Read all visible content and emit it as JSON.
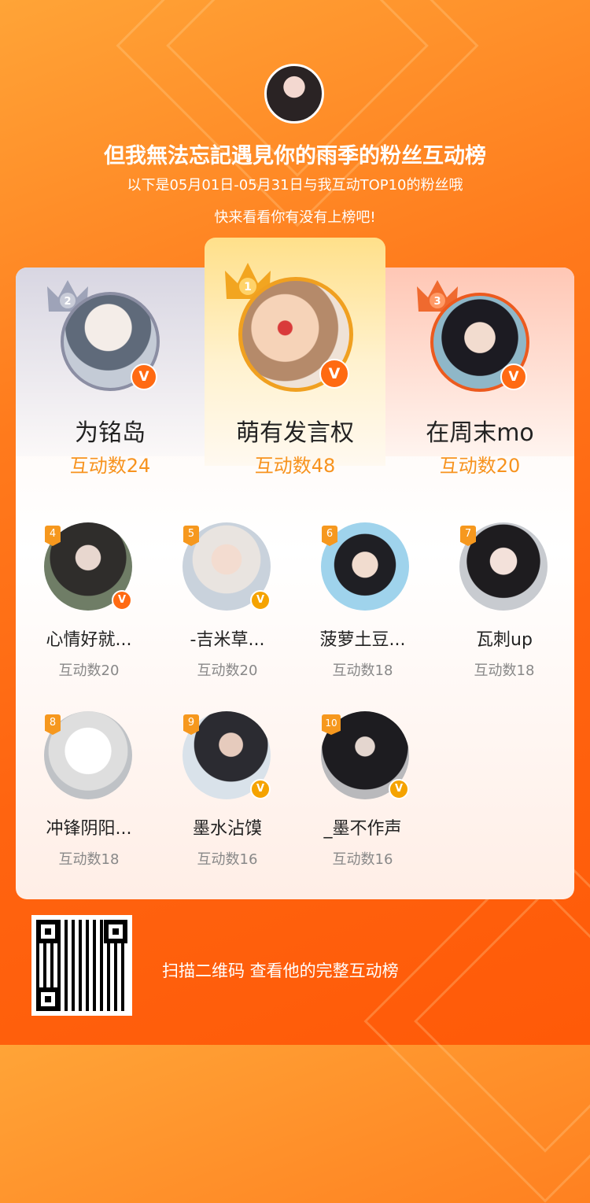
{
  "header": {
    "title": "但我無法忘記遇見你的雨季的粉丝互动榜",
    "subtitle_line1": "以下是05月01日-05月31日与我互动TOP10的粉丝哦",
    "subtitle_line2": "快来看看你有没有上榜吧!"
  },
  "top3": [
    {
      "rank": "1",
      "name": "萌有发言权",
      "count": "互动数48"
    },
    {
      "rank": "2",
      "name": "为铭岛",
      "count": "互动数24"
    },
    {
      "rank": "3",
      "name": "在周末mo",
      "count": "互动数20"
    }
  ],
  "fans": [
    {
      "rank": "4",
      "name": "心情好就...",
      "count": "互动数20"
    },
    {
      "rank": "5",
      "name": "-吉米草...",
      "count": "互动数20"
    },
    {
      "rank": "6",
      "name": "菠萝土豆...",
      "count": "互动数18"
    },
    {
      "rank": "7",
      "name": "瓦刺up",
      "count": "互动数18"
    },
    {
      "rank": "8",
      "name": "冲锋阴阳...",
      "count": "互动数18"
    },
    {
      "rank": "9",
      "name": "墨水沾馍",
      "count": "互动数16"
    },
    {
      "rank": "10",
      "name": "_墨不作声",
      "count": "互动数16"
    }
  ],
  "footer": {
    "scan_text": "扫描二维码 查看他的完整互动榜"
  },
  "badge_glyph": "V",
  "colors": {
    "accent": "#ff6a12",
    "count_gold": "#f7931e",
    "crown_gold": "#f2a520",
    "crown_silver": "#9ea3b8",
    "crown_bronze": "#ef6a2f"
  }
}
